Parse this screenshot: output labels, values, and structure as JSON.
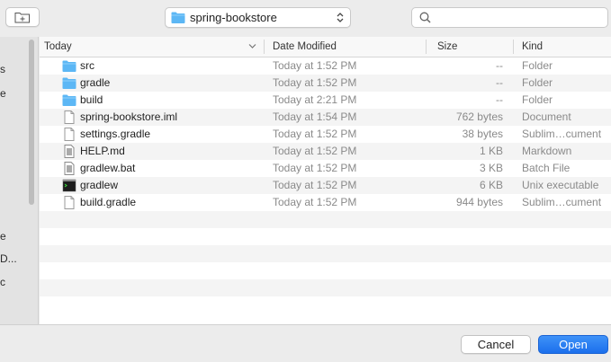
{
  "toolbar": {
    "location": "spring-bookstore",
    "search_placeholder": ""
  },
  "sidebar": {
    "fragments": [
      "s",
      "e",
      "e",
      "D...",
      "c"
    ]
  },
  "columns": {
    "name": "Today",
    "date": "Date Modified",
    "size": "Size",
    "kind": "Kind"
  },
  "files": [
    {
      "name": "src",
      "date": "Today at 1:52 PM",
      "size": "--",
      "kind": "Folder",
      "icon": "folder-icon"
    },
    {
      "name": "gradle",
      "date": "Today at 1:52 PM",
      "size": "--",
      "kind": "Folder",
      "icon": "folder-icon"
    },
    {
      "name": "build",
      "date": "Today at 2:21 PM",
      "size": "--",
      "kind": "Folder",
      "icon": "folder-icon"
    },
    {
      "name": "spring-bookstore.iml",
      "date": "Today at 1:54 PM",
      "size": "762 bytes",
      "kind": "Document",
      "icon": "document-icon"
    },
    {
      "name": "settings.gradle",
      "date": "Today at 1:52 PM",
      "size": "38 bytes",
      "kind": "Sublim…cument",
      "icon": "document-icon"
    },
    {
      "name": "HELP.md",
      "date": "Today at 1:52 PM",
      "size": "1 KB",
      "kind": "Markdown",
      "icon": "text-document-icon"
    },
    {
      "name": "gradlew.bat",
      "date": "Today at 1:52 PM",
      "size": "3 KB",
      "kind": "Batch File",
      "icon": "text-document-icon"
    },
    {
      "name": "gradlew",
      "date": "Today at 1:52 PM",
      "size": "6 KB",
      "kind": "Unix executable",
      "icon": "terminal-icon"
    },
    {
      "name": "build.gradle",
      "date": "Today at 1:52 PM",
      "size": "944 bytes",
      "kind": "Sublim…cument",
      "icon": "document-icon"
    }
  ],
  "buttons": {
    "cancel": "Cancel",
    "open": "Open"
  },
  "colors": {
    "accent": "#1b6fec",
    "folder": "#5cb7f5"
  }
}
